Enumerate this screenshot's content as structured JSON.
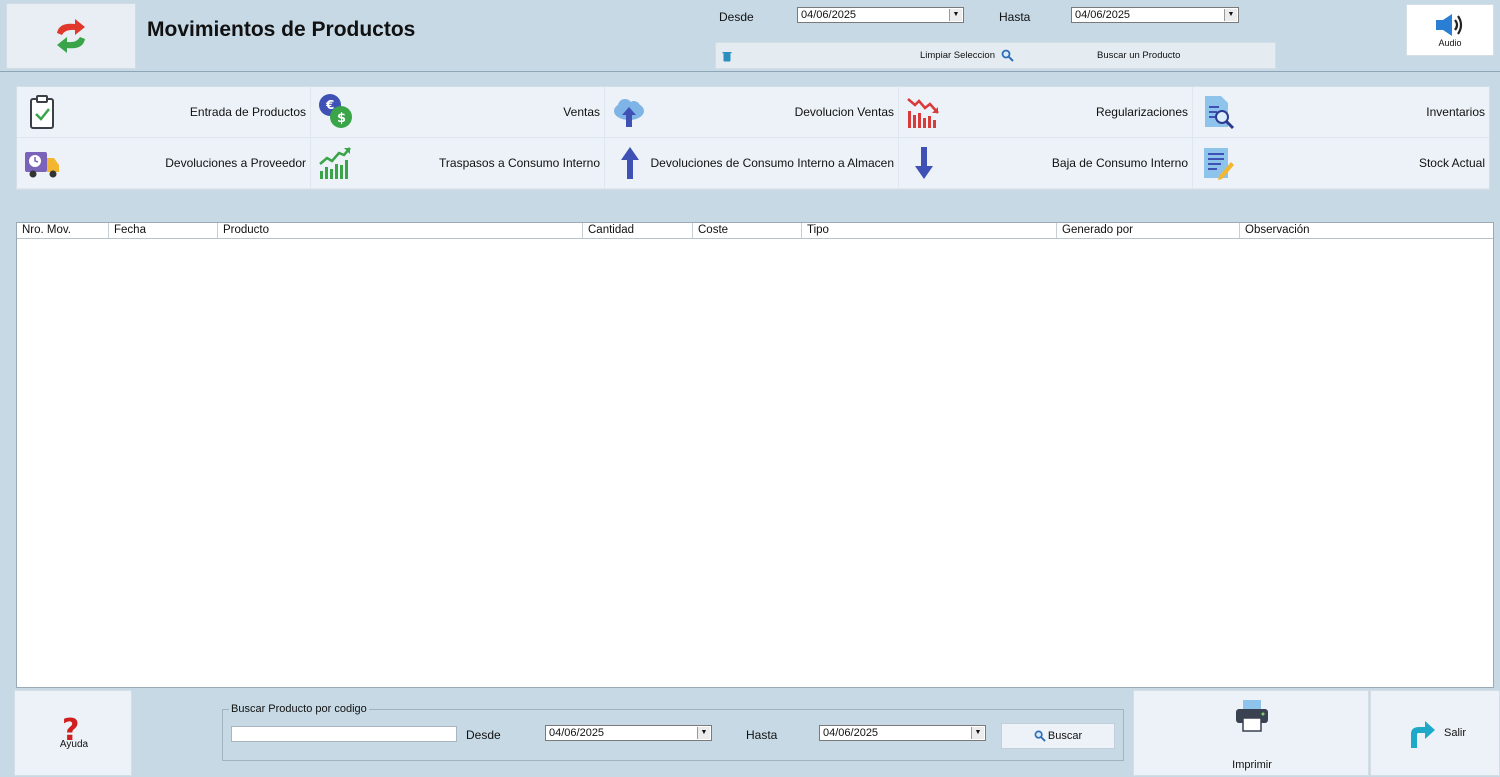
{
  "header": {
    "title": "Movimientos de Productos",
    "desde_label": "Desde",
    "desde_value": "04/06/2025",
    "hasta_label": "Hasta",
    "hasta_value": "04/06/2025",
    "limpiar_label": "Limpiar Seleccion",
    "buscar_producto_label": "Buscar un Producto",
    "audio_label": "Audio"
  },
  "tiles": [
    {
      "label": "Entrada de Productos",
      "icon": "clipboard-check-icon"
    },
    {
      "label": "Ventas",
      "icon": "euro-dollar-coins-icon"
    },
    {
      "label": "Devolucion Ventas",
      "icon": "cloud-upload-icon"
    },
    {
      "label": "Regularizaciones",
      "icon": "bar-chart-down-icon"
    },
    {
      "label": "Inventarios",
      "icon": "document-search-icon"
    },
    {
      "label": "Devoluciones a Proveedor",
      "icon": "delivery-truck-clock-icon"
    },
    {
      "label": "Traspasos a Consumo Interno",
      "icon": "bar-chart-up-icon"
    },
    {
      "label": "Devoluciones de Consumo Interno a Almacen",
      "icon": "arrow-up-icon"
    },
    {
      "label": "Baja de Consumo Interno",
      "icon": "arrow-down-icon"
    },
    {
      "label": "Stock Actual",
      "icon": "document-edit-icon"
    }
  ],
  "table": {
    "columns": [
      "Nro. Mov.",
      "Fecha",
      "Producto",
      "Cantidad",
      "Coste",
      "Tipo",
      "Generado por",
      "Observación"
    ],
    "rows": []
  },
  "footer": {
    "ayuda_label": "Ayuda",
    "legend": "Buscar Producto por codigo",
    "codigo_value": "",
    "desde_label": "Desde",
    "desde_value": "04/06/2025",
    "hasta_label": "Hasta",
    "hasta_value": "04/06/2025",
    "buscar_label": "Buscar",
    "imprimir_label": "Imprimir",
    "salir_label": "Salir"
  },
  "colors": {
    "background": "#c6d9e5",
    "panel": "#ecf2f7",
    "arrow_red": "#e0392b",
    "arrow_green": "#3aa548",
    "icon_blue": "#3f51b5"
  }
}
